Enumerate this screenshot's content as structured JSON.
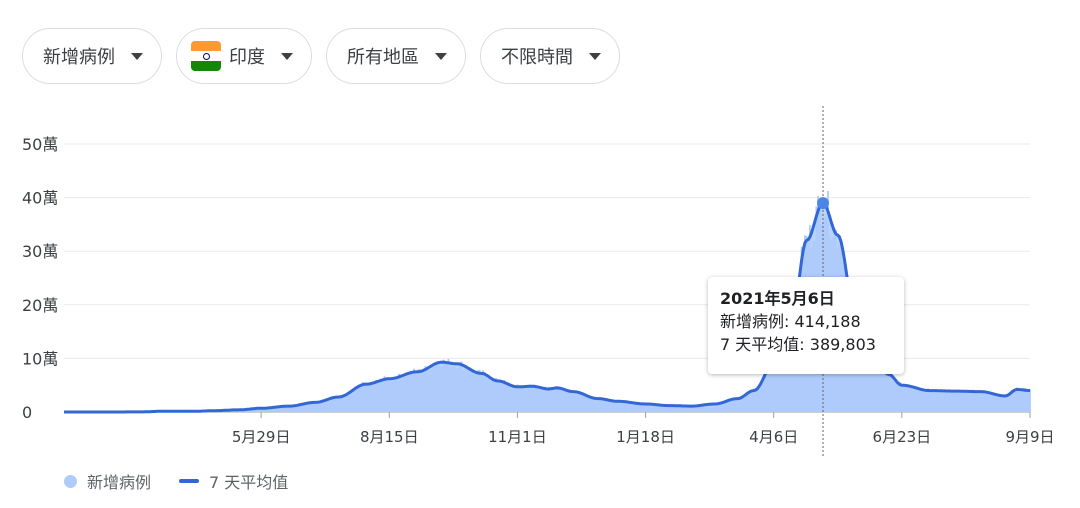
{
  "filters": {
    "metric": "新增病例",
    "country": "印度",
    "region": "所有地區",
    "period": "不限時間",
    "flag_colors": [
      "#FF9933",
      "#FFFFFF",
      "#138808"
    ]
  },
  "tooltip": {
    "date": "2021年5月6日",
    "line1_label": "新增病例",
    "line1_value": "414,188",
    "line2_label": "7 天平均值",
    "line2_value": "389,803"
  },
  "legend": {
    "bars": "新增病例",
    "avg": "7 天平均值"
  },
  "chart_data": {
    "type": "area",
    "y_ticks": [
      {
        "value": 0,
        "label": "0"
      },
      {
        "value": 100000,
        "label": "10萬"
      },
      {
        "value": 200000,
        "label": "20萬"
      },
      {
        "value": 300000,
        "label": "30萬"
      },
      {
        "value": 400000,
        "label": "40萬"
      },
      {
        "value": 500000,
        "label": "50萬"
      }
    ],
    "ylim": [
      0,
      500000
    ],
    "x_ticks": [
      {
        "label": "5月29日",
        "date": "2020-05-29"
      },
      {
        "label": "8月15日",
        "date": "2020-08-15"
      },
      {
        "label": "11月1日",
        "date": "2020-11-01"
      },
      {
        "label": "1月18日",
        "date": "2021-01-18"
      },
      {
        "label": "4月6日",
        "date": "2021-04-06"
      },
      {
        "label": "6月23日",
        "date": "2021-06-23"
      },
      {
        "label": "9月9日",
        "date": "2021-09-09"
      }
    ],
    "x_range": [
      "2020-01-30",
      "2021-09-09"
    ],
    "series": [
      {
        "name": "7 天平均值",
        "color": "#3367d6",
        "fill": "#aecbfa",
        "points": [
          [
            "2020-01-30",
            0
          ],
          [
            "2020-03-15",
            100
          ],
          [
            "2020-04-01",
            1500
          ],
          [
            "2020-04-20",
            1500
          ],
          [
            "2020-05-01",
            2500
          ],
          [
            "2020-05-15",
            4000
          ],
          [
            "2020-05-29",
            7000
          ],
          [
            "2020-06-15",
            11000
          ],
          [
            "2020-07-01",
            18000
          ],
          [
            "2020-07-15",
            28000
          ],
          [
            "2020-08-01",
            52000
          ],
          [
            "2020-08-15",
            62000
          ],
          [
            "2020-09-01",
            75000
          ],
          [
            "2020-09-16",
            93000
          ],
          [
            "2020-09-25",
            90000
          ],
          [
            "2020-10-10",
            72000
          ],
          [
            "2020-10-20",
            58000
          ],
          [
            "2020-11-01",
            47000
          ],
          [
            "2020-11-10",
            48000
          ],
          [
            "2020-11-20",
            43000
          ],
          [
            "2020-11-25",
            45000
          ],
          [
            "2020-12-05",
            38000
          ],
          [
            "2020-12-20",
            25000
          ],
          [
            "2021-01-01",
            20000
          ],
          [
            "2021-01-18",
            15000
          ],
          [
            "2021-02-01",
            12000
          ],
          [
            "2021-02-15",
            11000
          ],
          [
            "2021-03-01",
            15000
          ],
          [
            "2021-03-15",
            25000
          ],
          [
            "2021-03-25",
            40000
          ],
          [
            "2021-04-06",
            90000
          ],
          [
            "2021-04-18",
            200000
          ],
          [
            "2021-04-26",
            320000
          ],
          [
            "2021-05-06",
            389803
          ],
          [
            "2021-05-15",
            330000
          ],
          [
            "2021-05-25",
            200000
          ],
          [
            "2021-06-05",
            110000
          ],
          [
            "2021-06-15",
            70000
          ],
          [
            "2021-06-23",
            50000
          ],
          [
            "2021-07-10",
            40000
          ],
          [
            "2021-07-25",
            39000
          ],
          [
            "2021-08-10",
            38000
          ],
          [
            "2021-08-25",
            30000
          ],
          [
            "2021-09-01",
            42000
          ],
          [
            "2021-09-09",
            40000
          ]
        ]
      }
    ],
    "highlight": {
      "date": "2021-05-06",
      "value": 389803
    },
    "grid": true,
    "legend_position": "bottom-left"
  }
}
